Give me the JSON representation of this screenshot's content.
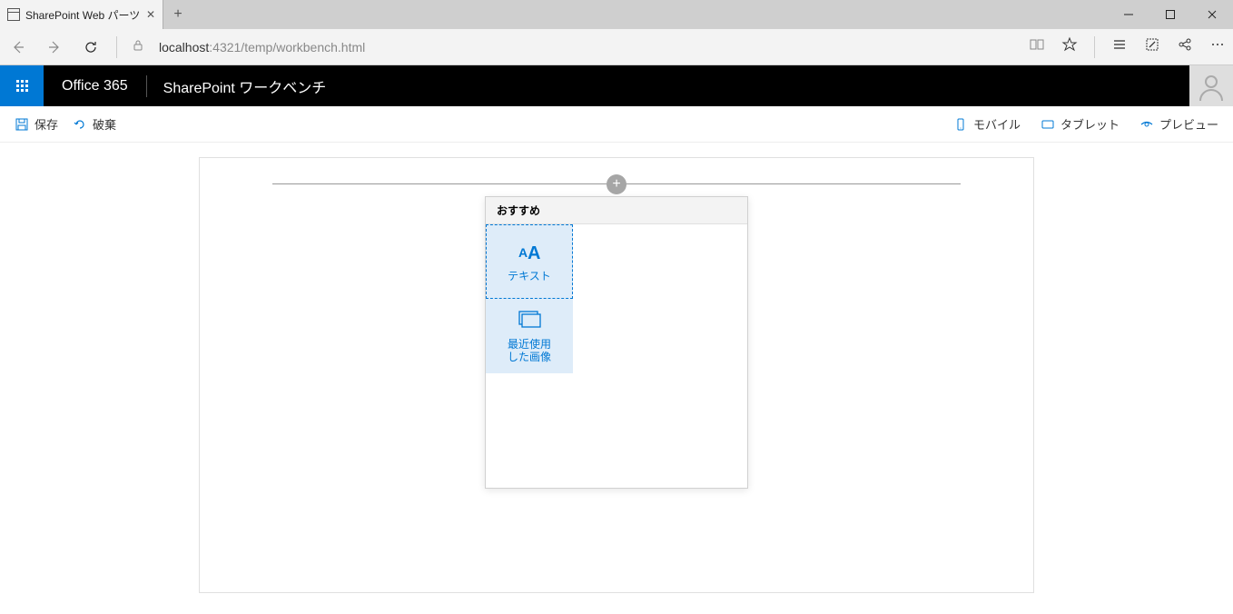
{
  "browser": {
    "tab_title": "SharePoint Web パーツ",
    "url_host": "localhost",
    "url_path": ":4321/temp/workbench.html"
  },
  "suitebar": {
    "brand": "Office 365",
    "app_title": "SharePoint ワークベンチ"
  },
  "cmdbar": {
    "save": "保存",
    "discard": "破棄",
    "mobile": "モバイル",
    "tablet": "タブレット",
    "preview": "プレビュー"
  },
  "toolbox": {
    "header": "おすすめ",
    "items": [
      {
        "label": "テキスト",
        "state": "selected"
      },
      {
        "label": "最近使用\nした画像",
        "state": "hover"
      }
    ]
  }
}
